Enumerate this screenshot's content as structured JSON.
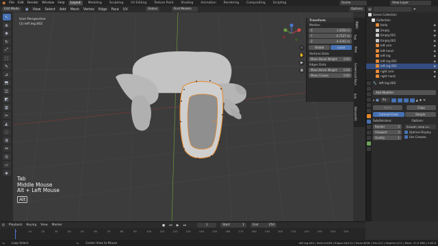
{
  "topbar": {
    "menus": [
      "File",
      "Edit",
      "Render",
      "Window",
      "Help"
    ],
    "workspaces": [
      "Layout",
      "Modeling",
      "Sculpting",
      "UV Editing",
      "Texture Paint",
      "Shading",
      "Animation",
      "Rendering",
      "Compositing",
      "Scripting"
    ],
    "active_workspace": "Layout",
    "scene_label": "Scene",
    "view_layer_label": "View Layer"
  },
  "viewport_header": {
    "mode": "Edit Mode",
    "menus": [
      "View",
      "Select",
      "Add",
      "Mesh",
      "Vertex",
      "Edge",
      "Face",
      "UV"
    ],
    "orientation": "Global",
    "find_models": "Find Models",
    "options": "Options"
  },
  "viewport": {
    "view_name": "User Perspective",
    "object_name": "(1) left leg.002",
    "keys": [
      "Tab",
      "Middle Mouse",
      "Alt + Left Mouse"
    ],
    "key_badge": "Alt",
    "axis_labels": {
      "y": "Y",
      "x": "X",
      "z": "Z"
    }
  },
  "npanel": {
    "section": "Transform",
    "median_label": "Median:",
    "x": {
      "label": "X",
      "value": "1.0458 m"
    },
    "y": {
      "label": "Y",
      "value": "-0.7127 m"
    },
    "z": {
      "label": "Z",
      "value": "-4.4342 m"
    },
    "global": "Global",
    "local": "Local",
    "vertices_data": "Vertices Data:",
    "mean_bevel_weight_v": {
      "label": "Mean Bevel Weight",
      "value": "0.00"
    },
    "edges_data": "Edges Data:",
    "mean_bevel_weight_e": {
      "label": "Mean Bevel Weight",
      "value": "0.00"
    },
    "mean_crease": {
      "label": "Mean Crease",
      "value": "0.00"
    },
    "tabs": [
      "Item",
      "Tool",
      "View",
      "Screencast Keys",
      "Edit",
      "BlenderKit"
    ]
  },
  "outliner": {
    "header": "Scene Collection",
    "items": [
      {
        "label": "Collection",
        "color": "#e0e0e0"
      },
      {
        "label": "body",
        "color": "#e58a3a"
      },
      {
        "label": "Empty",
        "color": "#c9c9c9"
      },
      {
        "label": "Empty.001",
        "color": "#c9c9c9"
      },
      {
        "label": "Empty.002",
        "color": "#c9c9c9"
      },
      {
        "label": "left arm",
        "color": "#e58a3a"
      },
      {
        "label": "left hand",
        "color": "#e58a3a"
      },
      {
        "label": "left leg",
        "color": "#e58a3a"
      },
      {
        "label": "left leg.001",
        "color": "#e58a3a"
      },
      {
        "label": "left leg.002",
        "color": "#e58a3a"
      },
      {
        "label": "right arm",
        "color": "#e58a3a"
      },
      {
        "label": "right hand",
        "color": "#e58a3a"
      }
    ],
    "selected_index": 9
  },
  "properties": {
    "object_name": "left leg.002",
    "add_modifier": "Add Modifier",
    "modifier_short": "Su",
    "apply": "Apply",
    "copy": "Copy",
    "catmull_clark": "Catmull-Clark",
    "simple": "Simple",
    "subdivisions": "Subdivisions:",
    "render": {
      "label": "Render",
      "value": "2"
    },
    "viewport": {
      "label": "Viewport",
      "value": "2"
    },
    "quality": {
      "label": "Quality",
      "value": "1"
    },
    "options": "Options:",
    "smooth": "Smooth, keep co...",
    "optimal_display": "Optimal Display",
    "use_creases": "Use Creases"
  },
  "timeline": {
    "menus": [
      "Playback",
      "Keying",
      "View",
      "Marker"
    ],
    "current_frame": "1",
    "start_label": "Start",
    "start": "1",
    "end_label": "End",
    "end": "250",
    "ticks": [
      "0",
      "10",
      "20",
      "30",
      "40",
      "50",
      "60",
      "70",
      "80",
      "90",
      "100",
      "110",
      "120",
      "130",
      "140",
      "150",
      "160",
      "170",
      "180",
      "190",
      "200",
      "210",
      "220",
      "230",
      "240",
      "250"
    ]
  },
  "status": {
    "left": "Loop Select",
    "middle": "Center View to Mouse",
    "right": "left leg.002 | Verts:24/56 | Edges:18/112 | Faces:8/56 | Tris:112 | Objects:1/11 | Mem: 27.0 MiB | 2.83.0"
  }
}
